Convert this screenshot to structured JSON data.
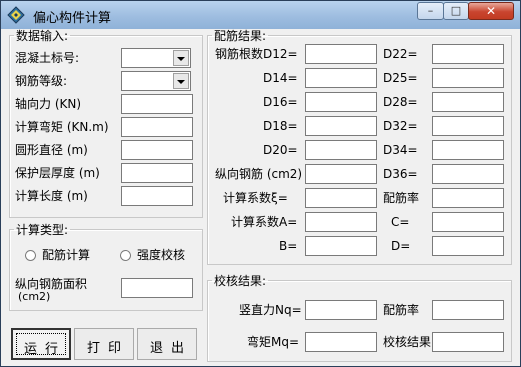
{
  "window": {
    "title": "偏心构件计算",
    "min_glyph": "–",
    "max_glyph": "□",
    "close_glyph": "✕"
  },
  "input_group": {
    "title": "数据输入:",
    "concrete_grade": {
      "label": "混凝土标号:",
      "value": ""
    },
    "steel_grade": {
      "label": "钢筋等级:",
      "value": ""
    },
    "axial_force": {
      "label": "轴向力 (KN)",
      "value": ""
    },
    "moment": {
      "label": "计算弯矩 (KN.m)",
      "value": ""
    },
    "diameter": {
      "label": "圆形直径 (m)",
      "value": ""
    },
    "cover": {
      "label": "保护层厚度 (m)",
      "value": ""
    },
    "length": {
      "label": "计算长度 (m)",
      "value": ""
    }
  },
  "calc_type_group": {
    "title": "计算类型:",
    "reinforcement_option": "配筋计算",
    "strength_check_option": "强度校核",
    "steel_area": {
      "label_line1": "纵向钢筋面积",
      "label_line2": "(cm2)",
      "value": ""
    }
  },
  "result_group": {
    "title": "配筋结果:",
    "d12": "钢筋根数D12=",
    "d14": "D14=",
    "d16": "D16=",
    "d18": "D18=",
    "d20": "D20=",
    "long_steel": "纵向钢筋 (cm2)",
    "coef_xi": "计算系数ξ=",
    "coef_a": "计算系数A=",
    "b": "B=",
    "d22": "D22=",
    "d25": "D25=",
    "d28": "D28=",
    "d32": "D32=",
    "d34": "D34=",
    "d36": "D36=",
    "ratio": "配筋率",
    "c": "C=",
    "d": "D="
  },
  "check_group": {
    "title": "校核结果:",
    "nq": "竖直力Nq=",
    "mq": "弯矩Mq=",
    "ratio": "配筋率",
    "result": "校核结果"
  },
  "buttons": {
    "run": "运行",
    "print": "打印",
    "exit": "退出"
  }
}
